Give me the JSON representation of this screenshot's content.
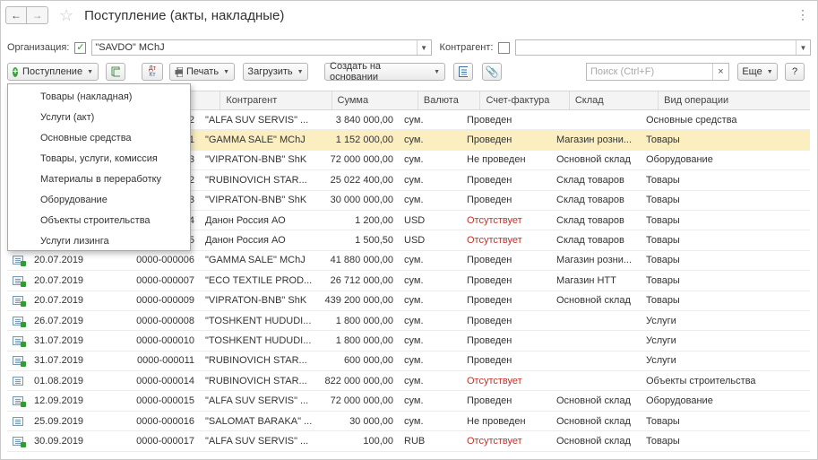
{
  "window": {
    "title": "Поступление (акты, накладные)"
  },
  "filters": {
    "org_label": "Организация:",
    "org_value": "\"SAVDO\" MChJ",
    "contractor_label": "Контрагент:",
    "contractor_value": ""
  },
  "toolbar": {
    "receipt": "Поступление",
    "print": "Печать",
    "load": "Загрузить",
    "create_basis": "Создать на основании",
    "search_placeholder": "Поиск (Ctrl+F)",
    "more": "Еще",
    "help": "?",
    "dtkt_top": "Дт",
    "dtkt_bottom": "Кт"
  },
  "columns": [
    "Контрагент",
    "Сумма",
    "Валюта",
    "Счет-фактура",
    "Склад",
    "Вид операции"
  ],
  "rows": [
    {
      "icon": "doc-posted",
      "date": "",
      "number": "2",
      "contractor": "\"ALFA SUV SERVIS\" ...",
      "sum": "3 840 000,00",
      "currency": "сум.",
      "invoice": "Проведен",
      "invoice_status": "normal",
      "warehouse": "",
      "operation": "Основные средства"
    },
    {
      "icon": "doc-posted",
      "date": "",
      "number": "1",
      "contractor": "\"GAMMA SALE\" MChJ",
      "sum": "1 152 000,00",
      "currency": "сум.",
      "invoice": "Проведен",
      "invoice_status": "normal",
      "warehouse": "Магазин розни...",
      "operation": "Товары",
      "selected": true
    },
    {
      "icon": "doc-posted",
      "date": "",
      "number": "3",
      "contractor": "\"VIPRATON-BNB\" ShK",
      "sum": "72 000 000,00",
      "currency": "сум.",
      "invoice": "Не проведен",
      "invoice_status": "normal",
      "warehouse": "Основной склад",
      "operation": "Оборудование"
    },
    {
      "icon": "doc-posted",
      "date": "",
      "number": "2",
      "contractor": "\"RUBINOVICH STAR...",
      "sum": "25 022 400,00",
      "currency": "сум.",
      "invoice": "Проведен",
      "invoice_status": "normal",
      "warehouse": "Склад товаров",
      "operation": "Товары"
    },
    {
      "icon": "doc-posted",
      "date": "",
      "number": "3",
      "contractor": "\"VIPRATON-BNB\" ShK",
      "sum": "30 000 000,00",
      "currency": "сум.",
      "invoice": "Проведен",
      "invoice_status": "normal",
      "warehouse": "Склад товаров",
      "operation": "Товары"
    },
    {
      "icon": "doc-posted",
      "date": "",
      "number": "4",
      "contractor": "Данон Россия АО",
      "sum": "1 200,00",
      "currency": "USD",
      "invoice": "Отсутствует",
      "invoice_status": "red",
      "warehouse": "Склад товаров",
      "operation": "Товары"
    },
    {
      "icon": "doc-posted",
      "date": "",
      "number": "5",
      "contractor": "Данон Россия АО",
      "sum": "1 500,50",
      "currency": "USD",
      "invoice": "Отсутствует",
      "invoice_status": "red",
      "warehouse": "Склад товаров",
      "operation": "Товары"
    },
    {
      "icon": "doc-posted",
      "date": "20.07.2019",
      "number": "0000-000006",
      "contractor": "\"GAMMA SALE\" MChJ",
      "sum": "41 880 000,00",
      "currency": "сум.",
      "invoice": "Проведен",
      "invoice_status": "normal",
      "warehouse": "Магазин розни...",
      "operation": "Товары"
    },
    {
      "icon": "doc-posted",
      "date": "20.07.2019",
      "number": "0000-000007",
      "contractor": "\"ECO TEXTILE PROD...",
      "sum": "26 712 000,00",
      "currency": "сум.",
      "invoice": "Проведен",
      "invoice_status": "normal",
      "warehouse": "Магазин НТТ",
      "operation": "Товары"
    },
    {
      "icon": "doc-posted",
      "date": "20.07.2019",
      "number": "0000-000009",
      "contractor": "\"VIPRATON-BNB\" ShK",
      "sum": "439 200 000,00",
      "currency": "сум.",
      "invoice": "Проведен",
      "invoice_status": "normal",
      "warehouse": "Основной склад",
      "operation": "Товары"
    },
    {
      "icon": "doc-posted",
      "date": "26.07.2019",
      "number": "0000-000008",
      "contractor": "\"TOSHKENT HUDUDI...",
      "sum": "1 800 000,00",
      "currency": "сум.",
      "invoice": "Проведен",
      "invoice_status": "normal",
      "warehouse": "",
      "operation": "Услуги"
    },
    {
      "icon": "doc-posted",
      "date": "31.07.2019",
      "number": "0000-000010",
      "contractor": "\"TOSHKENT HUDUDI...",
      "sum": "1 800 000,00",
      "currency": "сум.",
      "invoice": "Проведен",
      "invoice_status": "normal",
      "warehouse": "",
      "operation": "Услуги"
    },
    {
      "icon": "doc-posted",
      "date": "31.07.2019",
      "number": "0000-000011",
      "contractor": "\"RUBINOVICH STAR...",
      "sum": "600 000,00",
      "currency": "сум.",
      "invoice": "Проведен",
      "invoice_status": "normal",
      "warehouse": "",
      "operation": "Услуги"
    },
    {
      "icon": "doc",
      "date": "01.08.2019",
      "number": "0000-000014",
      "contractor": "\"RUBINOVICH STAR...",
      "sum": "822 000 000,00",
      "currency": "сум.",
      "invoice": "Отсутствует",
      "invoice_status": "red",
      "warehouse": "",
      "operation": "Объекты строительства"
    },
    {
      "icon": "doc-posted",
      "date": "12.09.2019",
      "number": "0000-000015",
      "contractor": "\"ALFA SUV SERVIS\" ...",
      "sum": "72 000 000,00",
      "currency": "сум.",
      "invoice": "Проведен",
      "invoice_status": "normal",
      "warehouse": "Основной склад",
      "operation": "Оборудование"
    },
    {
      "icon": "doc",
      "date": "25.09.2019",
      "number": "0000-000016",
      "contractor": "\"SALOMAT BARAKA\" ...",
      "sum": "30 000,00",
      "currency": "сум.",
      "invoice": "Не проведен",
      "invoice_status": "normal",
      "warehouse": "Основной склад",
      "operation": "Товары"
    },
    {
      "icon": "doc-posted",
      "date": "30.09.2019",
      "number": "0000-000017",
      "contractor": "\"ALFA SUV SERVIS\" ...",
      "sum": "100,00",
      "currency": "RUB",
      "invoice": "Отсутствует",
      "invoice_status": "red",
      "warehouse": "Основной склад",
      "operation": "Товары"
    }
  ],
  "menu": [
    "Товары (накладная)",
    "Услуги (акт)",
    "Основные средства",
    "Товары, услуги, комиссия",
    "Материалы в переработку",
    "Оборудование",
    "Объекты строительства",
    "Услуги лизинга"
  ],
  "colors": {
    "selected_row": "#fbeec1",
    "missing_invoice": "#c0332b",
    "posted_icon": "#2f9e2f"
  }
}
